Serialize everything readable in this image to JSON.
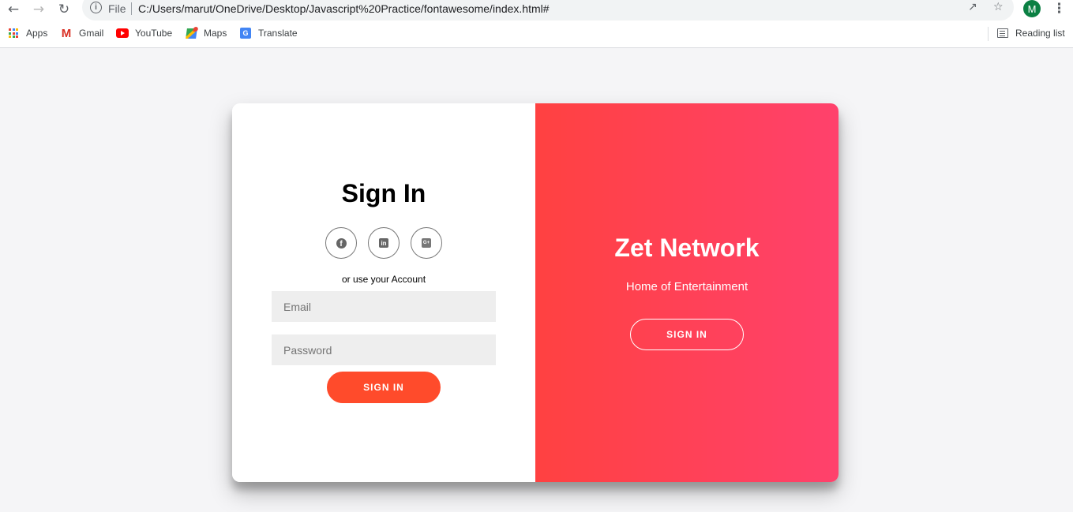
{
  "browser": {
    "address": {
      "scheme_label": "File",
      "url": "C:/Users/marut/OneDrive/Desktop/Javascript%20Practice/fontawesome/index.html#"
    },
    "profile_initial": "M",
    "bookmarks": [
      {
        "label": "Apps",
        "icon": "apps-grid-icon"
      },
      {
        "label": "Gmail",
        "icon": "gmail-icon"
      },
      {
        "label": "YouTube",
        "icon": "youtube-icon"
      },
      {
        "label": "Maps",
        "icon": "maps-icon"
      },
      {
        "label": "Translate",
        "icon": "translate-icon"
      }
    ],
    "reading_list_label": "Reading list"
  },
  "sign_in_form": {
    "title": "Sign In",
    "social": [
      {
        "name": "facebook",
        "icon": "facebook-icon"
      },
      {
        "name": "linkedin",
        "icon": "linkedin-icon"
      },
      {
        "name": "google-plus",
        "icon": "google-plus-icon",
        "glyph": "G+"
      }
    ],
    "subtext": "or use your Account",
    "email_placeholder": "Email",
    "password_placeholder": "Password",
    "submit_label": "SIGN IN"
  },
  "overlay": {
    "title": "Zet Network",
    "subtitle": "Home of Entertainment",
    "button_label": "SIGN IN"
  },
  "colors": {
    "accent": "#ff4b2b",
    "gradient_start": "#ff4141",
    "gradient_end": "#ff416c",
    "page_background": "#f5f5f7"
  }
}
